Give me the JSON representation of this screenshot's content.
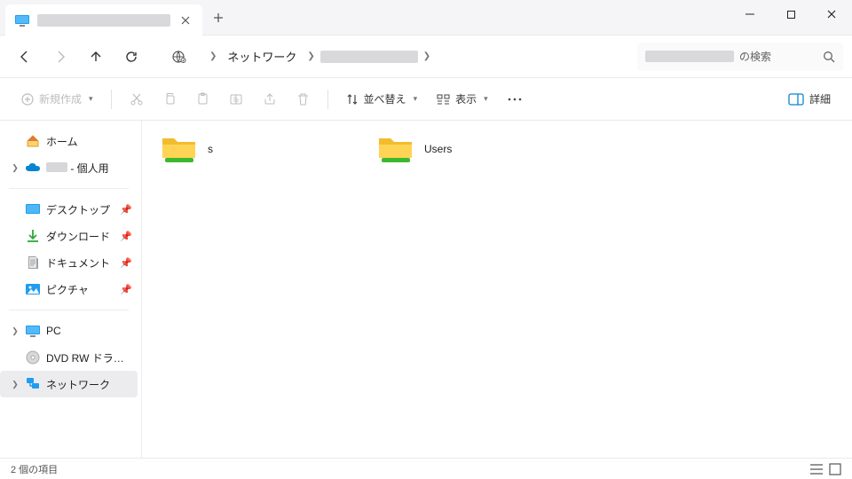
{
  "titlebar": {
    "tab_title_redacted": true,
    "new_tab_tooltip": "+"
  },
  "nav": {
    "back": "←",
    "forward": "→",
    "up": "↑",
    "refresh": "⟳"
  },
  "breadcrumb": {
    "root_label": "ネットワーク",
    "node_redacted": true
  },
  "search": {
    "suffix": "の検索",
    "placeholder_redacted": true
  },
  "toolbar": {
    "new_label": "新規作成",
    "sort_label": "並べ替え",
    "view_label": "表示",
    "details_label": "詳細"
  },
  "sidebar": {
    "home": "ホーム",
    "personal_suffix": " - 個人用",
    "personal_redacted": true,
    "desktop": "デスクトップ",
    "downloads": "ダウンロード",
    "documents": "ドキュメント",
    "pictures": "ピクチャ",
    "pc": "PC",
    "dvd": "DVD RW ドライブ (D:)",
    "network": "ネットワーク"
  },
  "files": [
    {
      "name": "s",
      "type": "network-share"
    },
    {
      "name": "Users",
      "type": "network-share"
    }
  ],
  "status": {
    "count_label": "2 個の項目"
  }
}
